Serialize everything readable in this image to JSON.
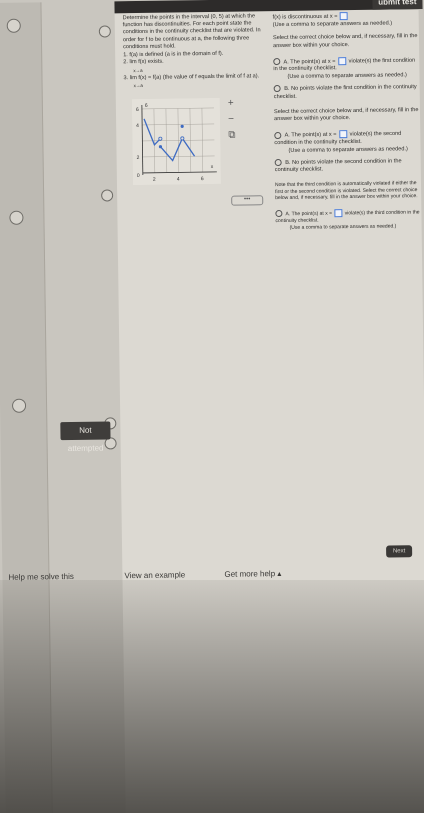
{
  "header": {
    "submit_label": "ubmit test"
  },
  "sidebar": {
    "status_label": "Not attempted"
  },
  "question": {
    "prompt": "Determine the points in the interval (0, 5) at which the function has discontinuities. For each point state the conditions in the continuity checklist that are violated. In order for f to be continuous at a, the following three conditions must hold.",
    "cond1": "1. f(a) is defined (a is in the domain of f).",
    "cond2": "2. lim f(x) exists.",
    "cond2_sub": "x→a",
    "cond3": "3. lim f(x) = f(a) (the value of f equals the limit of f at a).",
    "cond3_sub": "x→a"
  },
  "graph": {
    "y_label": "6",
    "y_ticks": [
      "6",
      "4",
      "2",
      "0"
    ],
    "x_ticks": [
      "2",
      "4",
      "6"
    ],
    "x_axis_label": "x"
  },
  "tools": {
    "zoom_in": "+",
    "zoom_out": "−",
    "open": "⧉"
  },
  "answers": {
    "header1": "f(x) is discontinuous at x =",
    "header2": "(Use a comma to separate answers as needed.)",
    "select1": "Select the correct choice below and, if necessary, fill in the answer box within your choice.",
    "q1_a": "A.  The point(s) at x =",
    "q1_a_tail": "violate(s) the first condition in the continuity checklist.",
    "q1_a_note": "(Use a comma to separate answers as needed.)",
    "q1_b": "B.  No points violate the first condition in the continuity checklist.",
    "select2": "Select the correct choice below and, if necessary, fill in the answer box within your choice.",
    "q2_a": "A.  The point(s) at x =",
    "q2_a_tail": "violate(s) the second condition in the continuity checklist.",
    "q2_a_note": "(Use a comma to separate answers as needed.)",
    "q2_b": "B.  No points violate the second condition in the continuity checklist.",
    "note3": "Note that the third condition is automatically violated if either the first or the second condition is violated. Select the correct choice below and, if necessary, fill in the answer box within your choice.",
    "q3_a": "A.  The point(s) at x =",
    "q3_a_tail": "violate(s) the third condition in the continuity checklist.",
    "q3_a_note": "(Use a comma to separate answers as needed.)"
  },
  "footer": {
    "help_solve": "Help me solve this",
    "view_example": "View an example",
    "more_help": "Get more help ▴",
    "next_label": "Next"
  },
  "divider": {
    "dots": "•••"
  }
}
